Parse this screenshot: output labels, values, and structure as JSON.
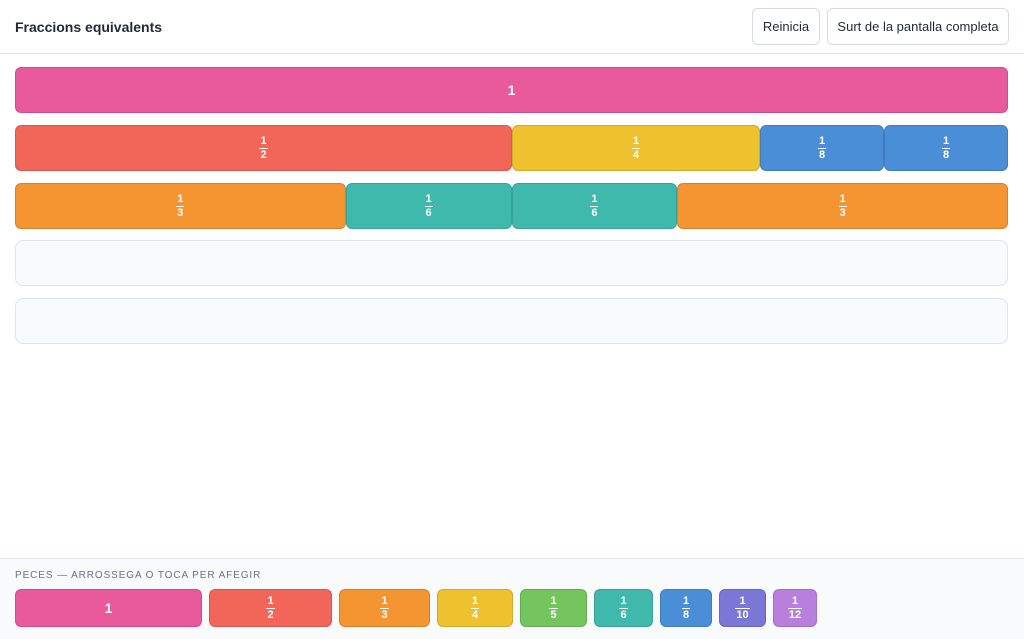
{
  "header": {
    "title": "Fraccions equivalents",
    "reset_label": "Reinicia",
    "fullscreen_label": "Surt de la pantalla completa"
  },
  "colors": {
    "whole": "#e95a9c",
    "half": "#f2665a",
    "third": "#f59532",
    "quarter": "#eec12f",
    "fifth": "#74c55e",
    "sixth": "#40b9ad",
    "eighth": "#4a8ed8",
    "tenth": "#7a77d6",
    "twelfth": "#b97fdc"
  },
  "board": {
    "rows": [
      {
        "pieces": [
          {
            "num": "1",
            "den": "",
            "color": "#e95a9c",
            "fraction": 1
          }
        ]
      },
      {
        "pieces": [
          {
            "num": "1",
            "den": "2",
            "color": "#f2665a",
            "fraction": 0.5
          },
          {
            "num": "1",
            "den": "4",
            "color": "#eec12f",
            "fraction": 0.25
          },
          {
            "num": "1",
            "den": "8",
            "color": "#4a8ed8",
            "fraction": 0.125
          },
          {
            "num": "1",
            "den": "8",
            "color": "#4a8ed8",
            "fraction": 0.125
          }
        ]
      },
      {
        "pieces": [
          {
            "num": "1",
            "den": "3",
            "color": "#f59532",
            "fraction": 0.3333
          },
          {
            "num": "1",
            "den": "6",
            "color": "#40b9ad",
            "fraction": 0.1667
          },
          {
            "num": "1",
            "den": "6",
            "color": "#40b9ad",
            "fraction": 0.1667
          },
          {
            "num": "1",
            "den": "3",
            "color": "#f59532",
            "fraction": 0.3333
          }
        ]
      },
      {
        "pieces": []
      },
      {
        "pieces": []
      }
    ]
  },
  "palette": {
    "label": "PECES — ARROSSEGA O TOCA PER AFEGIR",
    "pieces": [
      {
        "num": "1",
        "den": "",
        "color": "#e95a9c"
      },
      {
        "num": "1",
        "den": "2",
        "color": "#f2665a"
      },
      {
        "num": "1",
        "den": "3",
        "color": "#f59532"
      },
      {
        "num": "1",
        "den": "4",
        "color": "#eec12f"
      },
      {
        "num": "1",
        "den": "5",
        "color": "#74c55e"
      },
      {
        "num": "1",
        "den": "6",
        "color": "#40b9ad"
      },
      {
        "num": "1",
        "den": "8",
        "color": "#4a8ed8"
      },
      {
        "num": "1",
        "den": "10",
        "color": "#7a77d6"
      },
      {
        "num": "1",
        "den": "12",
        "color": "#b97fdc"
      }
    ]
  }
}
